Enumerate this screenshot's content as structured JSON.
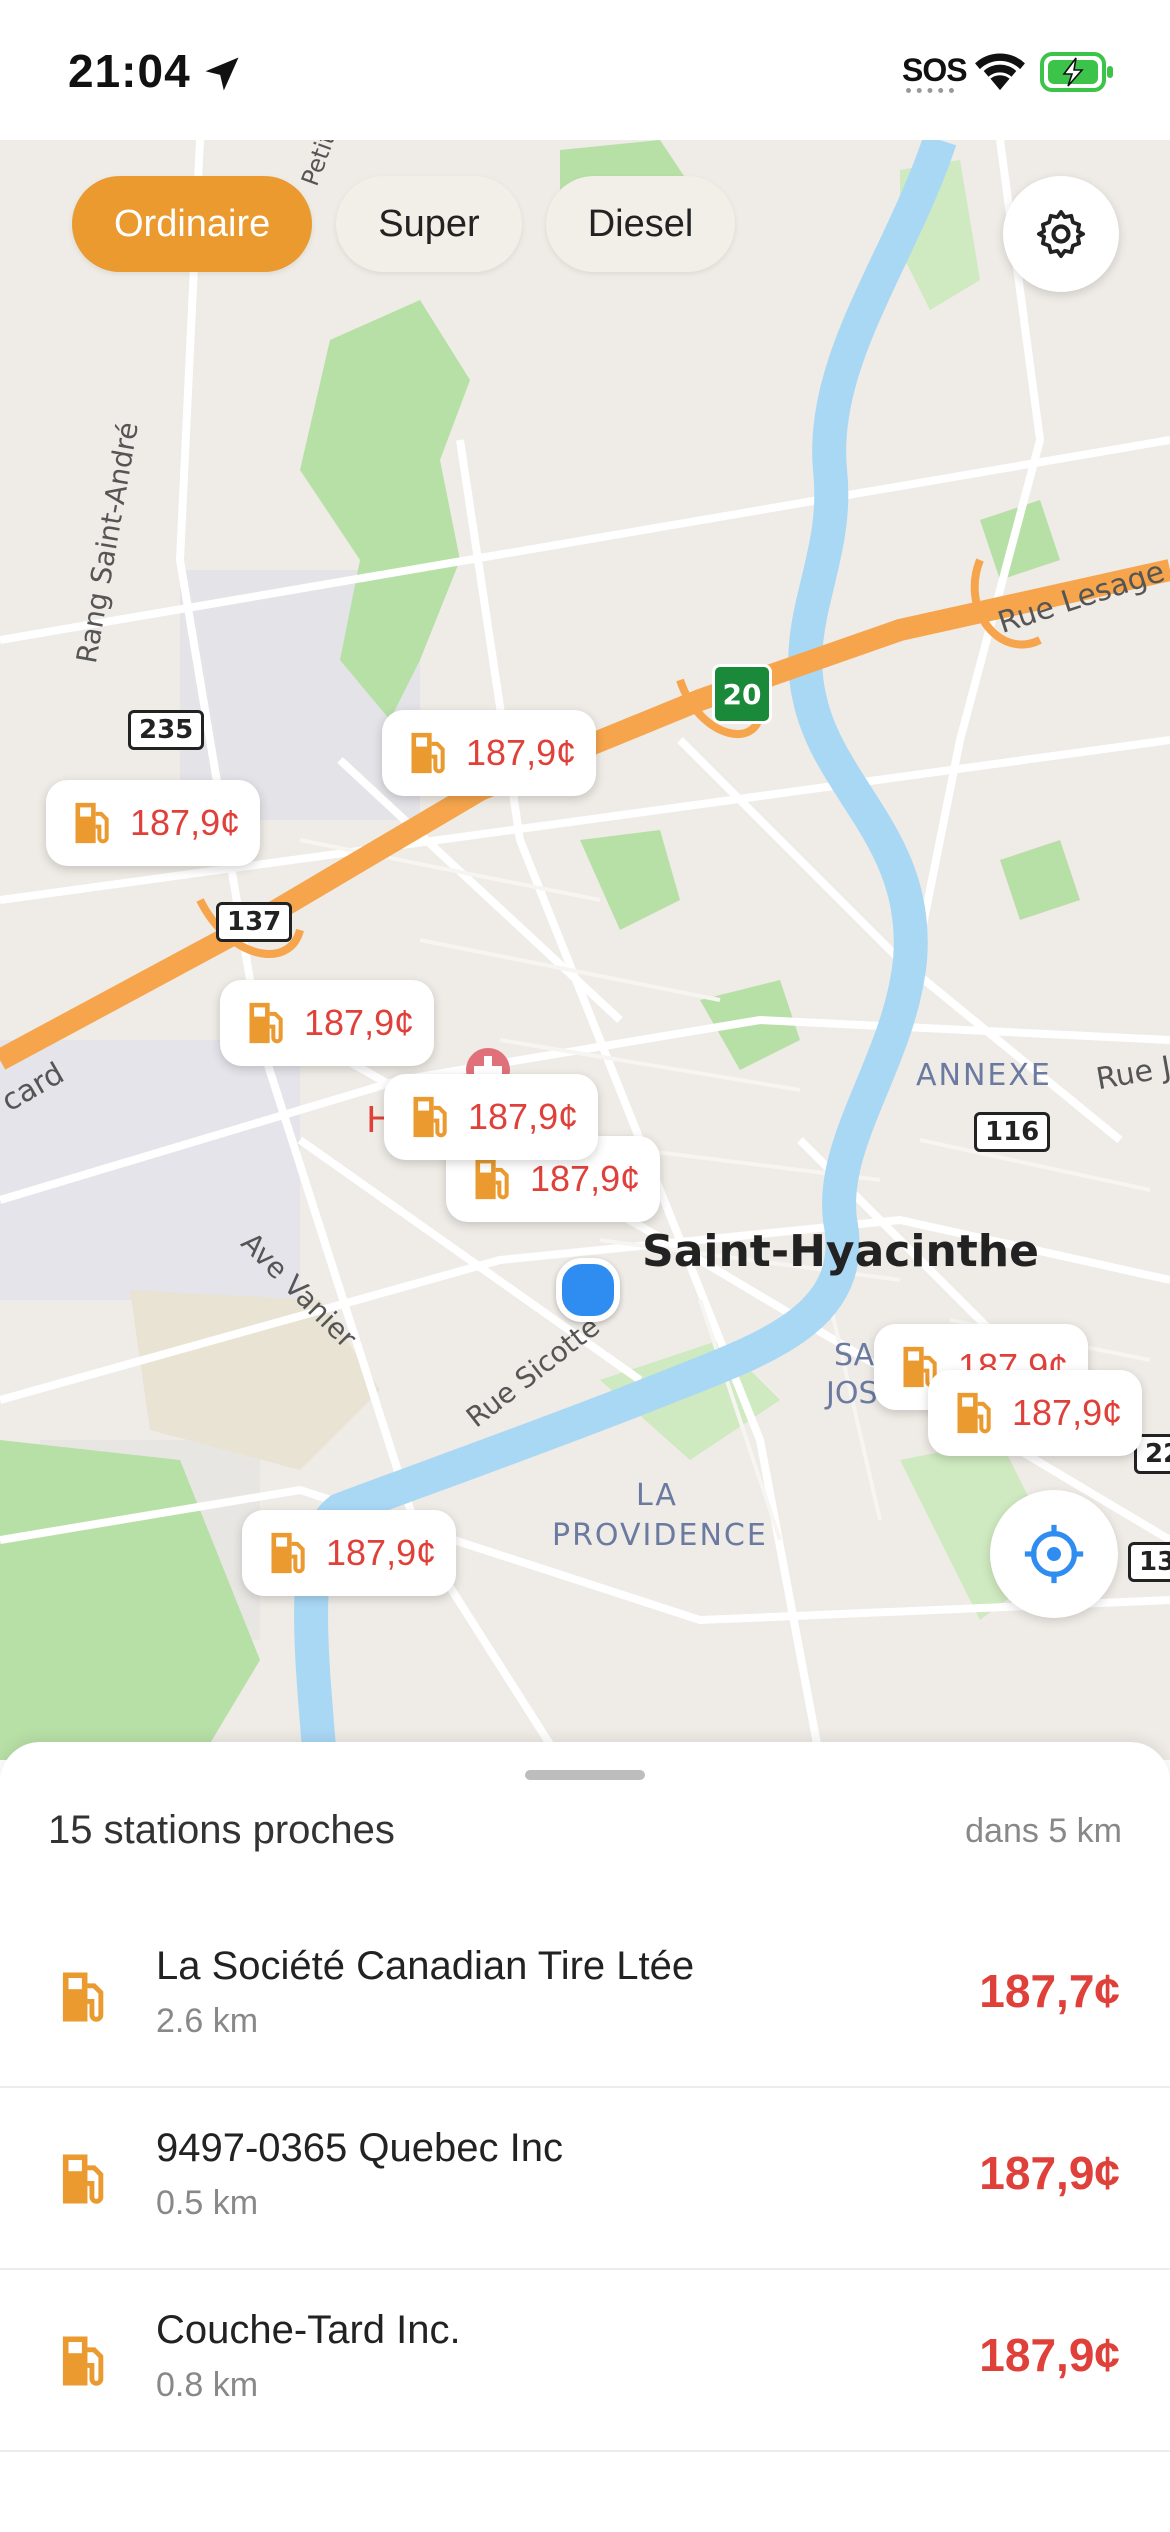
{
  "status": {
    "time": "21:04",
    "sos": "SOS"
  },
  "filters": {
    "items": [
      "Ordinaire",
      "Super",
      "Diesel"
    ],
    "active_index": 0
  },
  "colors": {
    "accent": "#ea9a2e",
    "price_red": "#e0403a",
    "water": "#a9d8f5",
    "park": "#b7e0a6",
    "highway": "#f6a54c"
  },
  "map": {
    "city_label": "Saint-Hyacinthe",
    "labels": {
      "rang": "Rang Saint-André",
      "rue_lesage": "Rue Lesage",
      "annexe": "ANNEXE",
      "rue_j": "Rue J",
      "ave_vanier": "Ave Vanier",
      "rue_sicotte": "Rue Sicotte",
      "la": "LA",
      "providence": "PROVIDENCE",
      "card": "card",
      "sa": "SA",
      "jos": "JOS",
      "petit": "Petit",
      "h_label": "H"
    },
    "shields": {
      "r235": "235",
      "r137": "137",
      "r116": "116",
      "a20": "20",
      "r22": "22",
      "r13": "13"
    },
    "markers": [
      {
        "price": "187,9¢"
      },
      {
        "price": "187,9¢"
      },
      {
        "price": "187,9¢"
      },
      {
        "price": "187,9¢"
      },
      {
        "price": "187,9¢"
      },
      {
        "price": "187,9¢"
      },
      {
        "price": "187,9¢"
      },
      {
        "price": "187,9¢"
      }
    ]
  },
  "sheet": {
    "title": "15 stations proches",
    "radius": "dans 5 km",
    "stations": [
      {
        "name": "La Société Canadian Tire Ltée",
        "distance": "2.6 km",
        "price": "187,7¢"
      },
      {
        "name": "9497-0365 Quebec Inc",
        "distance": "0.5 km",
        "price": "187,9¢"
      },
      {
        "name": "Couche-Tard Inc.",
        "distance": "0.8 km",
        "price": "187,9¢"
      }
    ]
  }
}
